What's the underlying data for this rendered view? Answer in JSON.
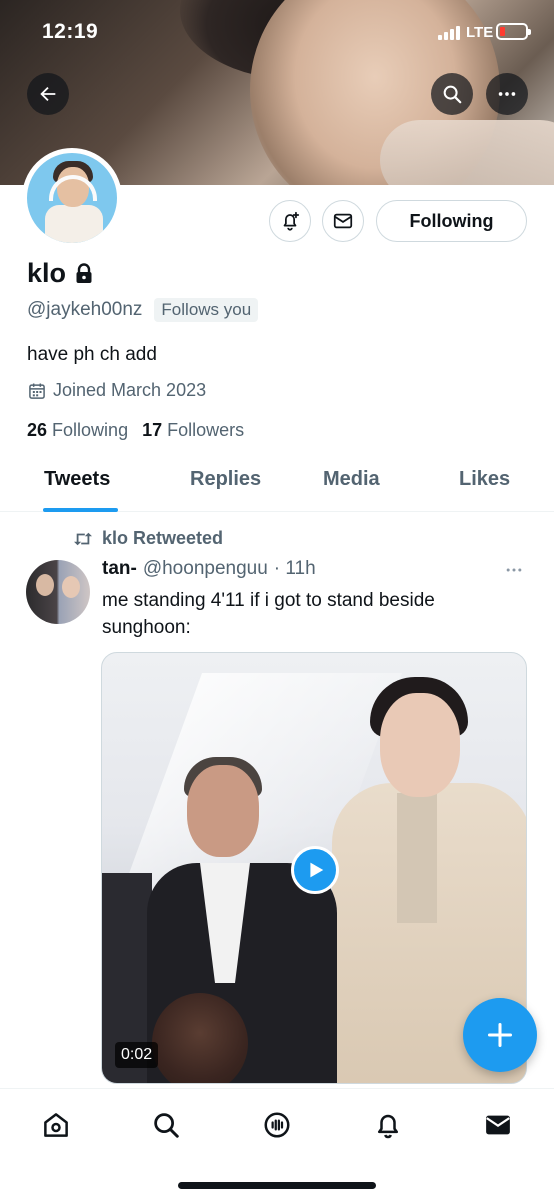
{
  "status_bar": {
    "time": "12:19",
    "network": "LTE"
  },
  "profile": {
    "display_name": "klo",
    "handle": "@jaykeh00nz",
    "follows_you_badge": "Follows you",
    "bio": "have ph ch add",
    "joined": "Joined March 2023",
    "following_count": "26",
    "following_label": "Following",
    "followers_count": "17",
    "followers_label": "Followers",
    "following_button_label": "Following"
  },
  "tabs": [
    {
      "label": "Tweets",
      "active": true
    },
    {
      "label": "Replies",
      "active": false
    },
    {
      "label": "Media",
      "active": false
    },
    {
      "label": "Likes",
      "active": false
    }
  ],
  "tweet": {
    "retweet_label": "klo Retweeted",
    "author_name": "tan-",
    "author_handle": "@hoonpenguu",
    "time": "· 11h",
    "text": "me standing 4'11 if i got to stand beside sunghoon:",
    "video_duration": "0:02"
  },
  "icons": {
    "back": "arrow-left-icon",
    "search": "search-icon",
    "more": "more-horizontal-icon",
    "lock": "lock-icon",
    "notify": "bell-plus-icon",
    "message": "envelope-icon",
    "calendar": "calendar-icon",
    "retweet": "retweet-icon",
    "play": "play-icon",
    "compose": "plus-icon",
    "nav": [
      "home-icon",
      "search-icon",
      "spaces-icon",
      "bell-icon",
      "mail-icon"
    ]
  },
  "colors": {
    "accent": "#1d9bf0",
    "text_primary": "#0f1419",
    "text_secondary": "#536471",
    "border": "#cfd9de",
    "battery_low": "#ff3b30"
  }
}
